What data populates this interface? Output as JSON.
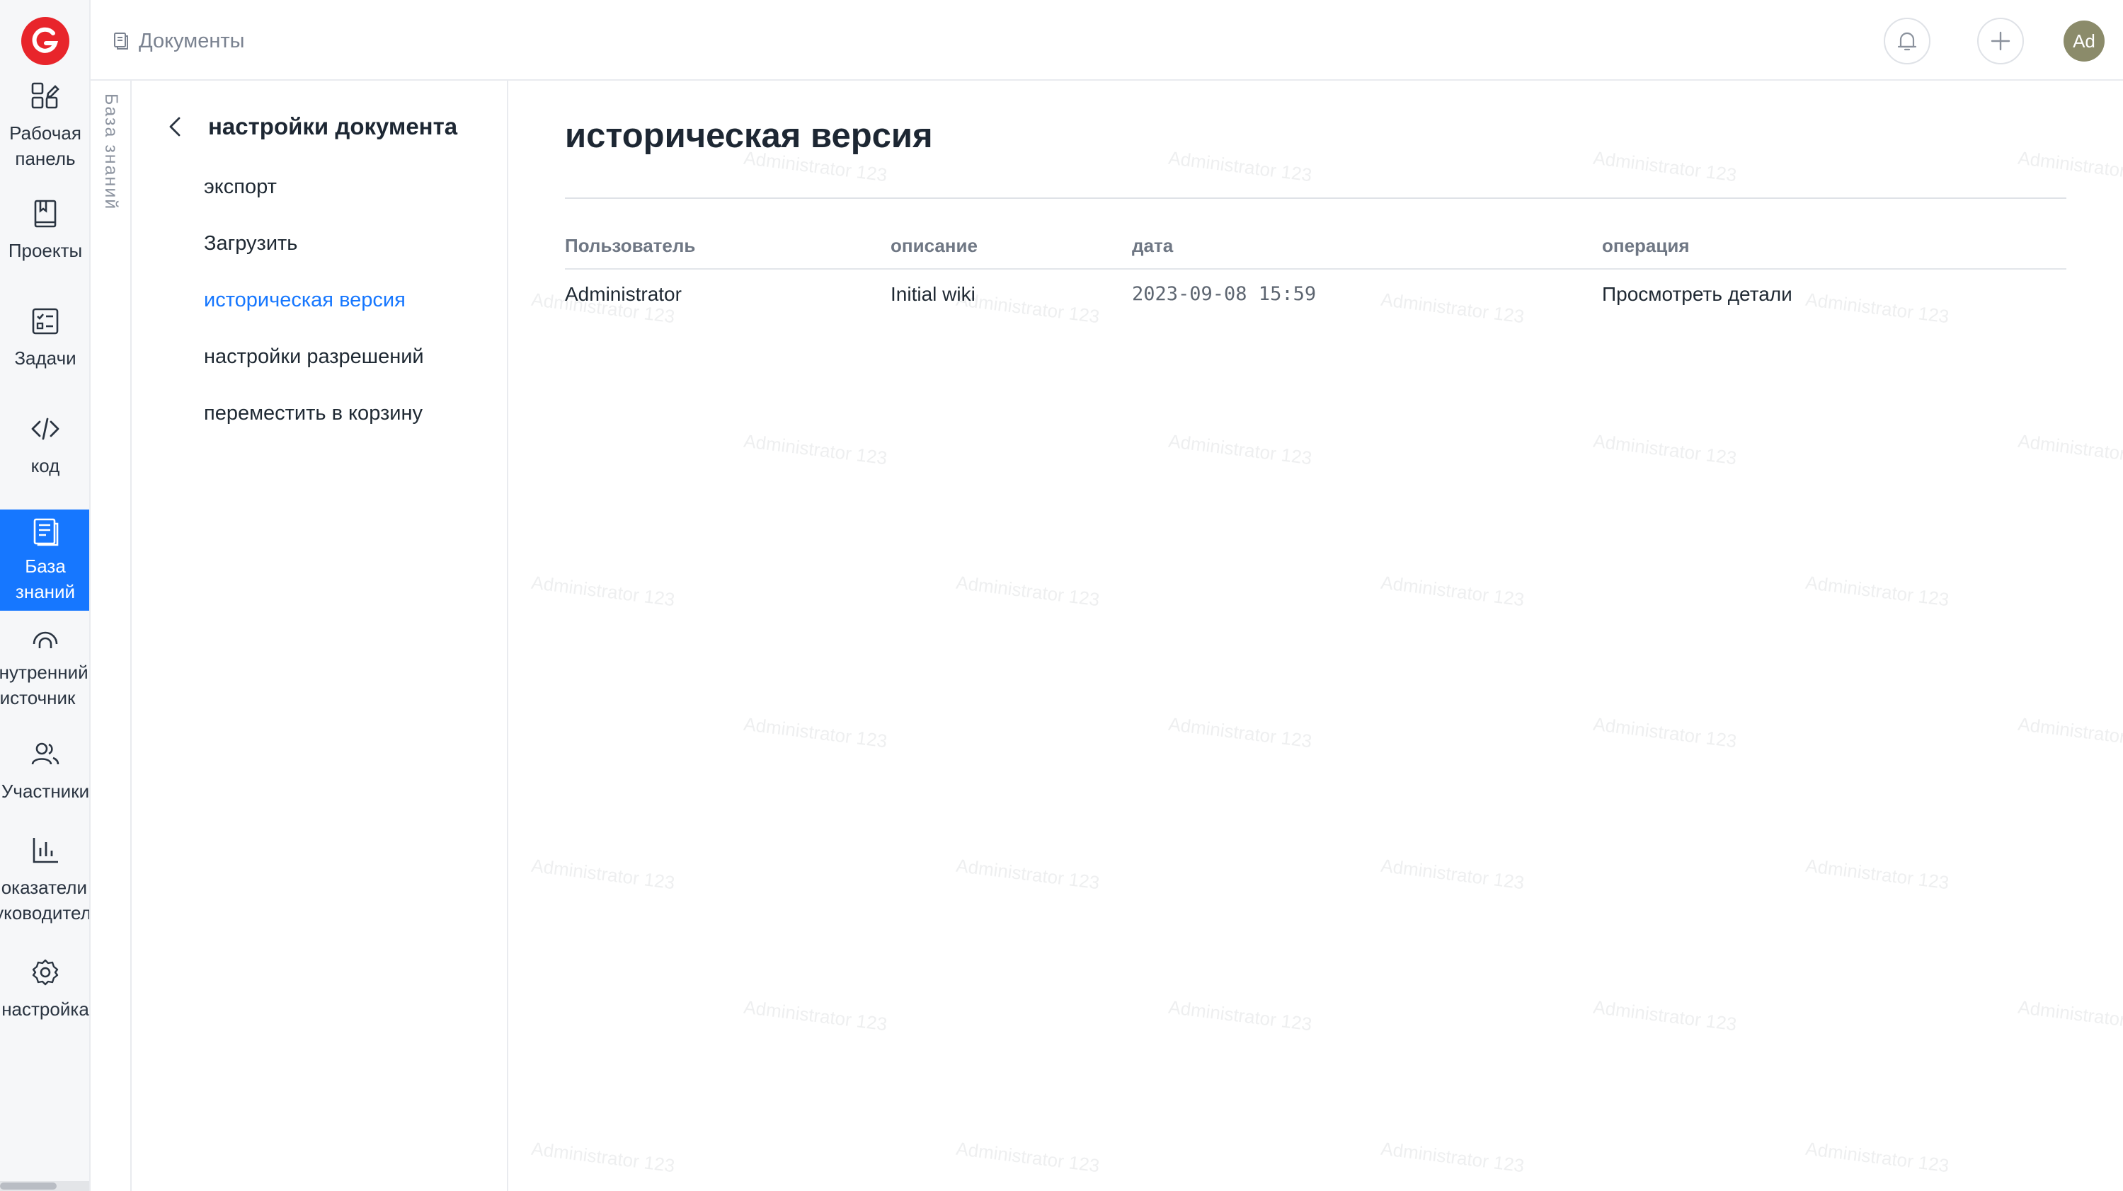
{
  "nav": {
    "items": [
      {
        "label": "Рабочая панель",
        "icon": "dashboard-icon"
      },
      {
        "label": "Проекты",
        "icon": "book-icon"
      },
      {
        "label": "Задачи",
        "icon": "task-list-icon"
      },
      {
        "label": "код",
        "icon": "code-icon"
      },
      {
        "label": "База знаний",
        "icon": "document-icon",
        "active": true
      },
      {
        "label": "Внутренний источник",
        "icon": "inner-source-icon"
      },
      {
        "label": "Участники",
        "icon": "users-icon"
      },
      {
        "label": "Показатели руководитель",
        "icon": "bar-chart-icon"
      },
      {
        "label": "настройка",
        "icon": "gear-icon"
      }
    ]
  },
  "header": {
    "breadcrumb": "Документы",
    "avatar_initials": "Ad"
  },
  "strip": {
    "label": "База знаний"
  },
  "settings": {
    "title": "настройки документа",
    "menu": [
      {
        "label": "экспорт"
      },
      {
        "label": "Загрузить"
      },
      {
        "label": "историческая версия",
        "active": true
      },
      {
        "label": "настройки разрешений"
      },
      {
        "label": "переместить в корзину"
      }
    ]
  },
  "page": {
    "title": "историческая версия",
    "columns": {
      "user": "Пользователь",
      "description": "описание",
      "date": "дата",
      "operation": "операция"
    },
    "rows": [
      {
        "user": "Administrator",
        "description": "Initial wiki",
        "date": "2023-09-08 15:59",
        "operation": "Просмотреть детали"
      }
    ]
  },
  "watermark": "Administrator 123",
  "colors": {
    "accent": "#1677ff",
    "logo": "#e8252b",
    "avatar": "#8b8b6a"
  }
}
